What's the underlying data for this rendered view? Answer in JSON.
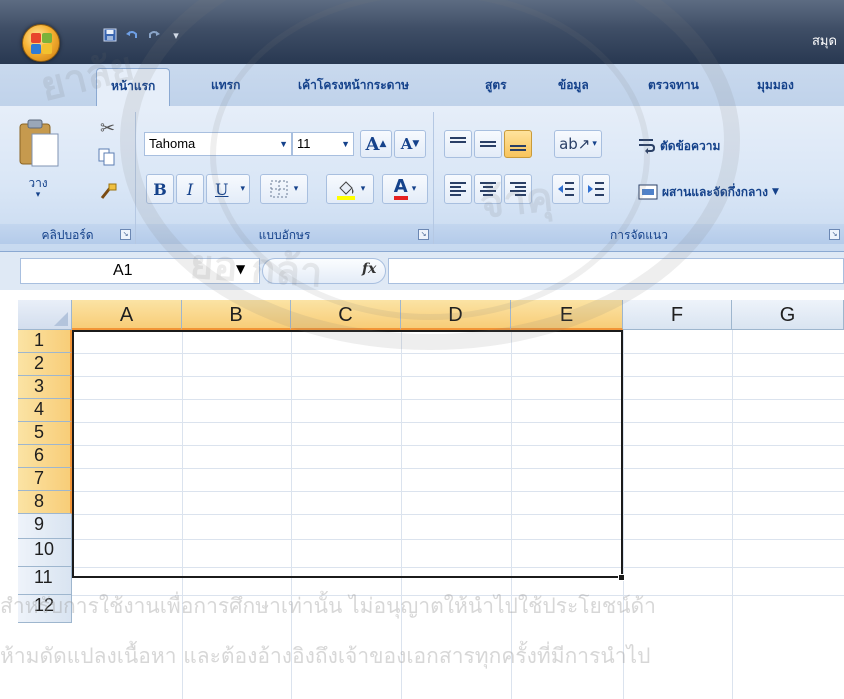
{
  "title_bar": {
    "app_title": "สมุด",
    "quick_access": [
      "save-icon",
      "undo-icon",
      "redo-icon",
      "customize-icon"
    ]
  },
  "tabs": [
    {
      "label": "หน้าแรก",
      "active": true
    },
    {
      "label": "แทรก",
      "active": false
    },
    {
      "label": "เค้าโครงหน้ากระดาษ",
      "active": false
    },
    {
      "label": "สูตร",
      "active": false
    },
    {
      "label": "ข้อมูล",
      "active": false
    },
    {
      "label": "ตรวจทาน",
      "active": false
    },
    {
      "label": "มุมมอง",
      "active": false
    }
  ],
  "ribbon": {
    "clipboard": {
      "paste_label": "วาง",
      "group_label": "คลิปบอร์ด"
    },
    "font": {
      "font_name": "Tahoma",
      "font_size": "11",
      "bold": "B",
      "italic": "I",
      "underline": "U",
      "grow": "A",
      "shrink": "A",
      "font_color": "A",
      "group_label": "แบบอักษร"
    },
    "alignment": {
      "wrap_text": "ตัดข้อความ",
      "merge_center": "ผสานและจัดกึ่งกลาง",
      "group_label": "การจัดแนว"
    }
  },
  "formula_bar": {
    "name_box": "A1",
    "fx": "fx",
    "value": ""
  },
  "sheet": {
    "columns": [
      "A",
      "B",
      "C",
      "D",
      "E",
      "F",
      "G"
    ],
    "rows": [
      "1",
      "2",
      "3",
      "4",
      "5",
      "6",
      "7",
      "8",
      "9",
      "10",
      "11",
      "12"
    ],
    "selected_range": "A1:E8"
  },
  "watermark": {
    "line1": "สำหรับการใช้งานเพื่อการศึกษาเท่านั้น ไม่อนุญาตให้นำไปใช้ประโยชน์ด้า",
    "line2": "ห้ามดัดแปลงเนื้อหา และต้องอ้างอิงถึงเจ้าของเอกสารทุกครั้งที่มีการนำไป",
    "seal_text_1": "ยาลัย",
    "seal_text_2": "จ้าคุ",
    "seal_text_3": "ยอ  กล้า"
  },
  "colors": {
    "title_bar": "#3f4e66",
    "ribbon": "#dfe9f5",
    "selected_header": "#f8cd78",
    "tab_text": "#15428b"
  }
}
